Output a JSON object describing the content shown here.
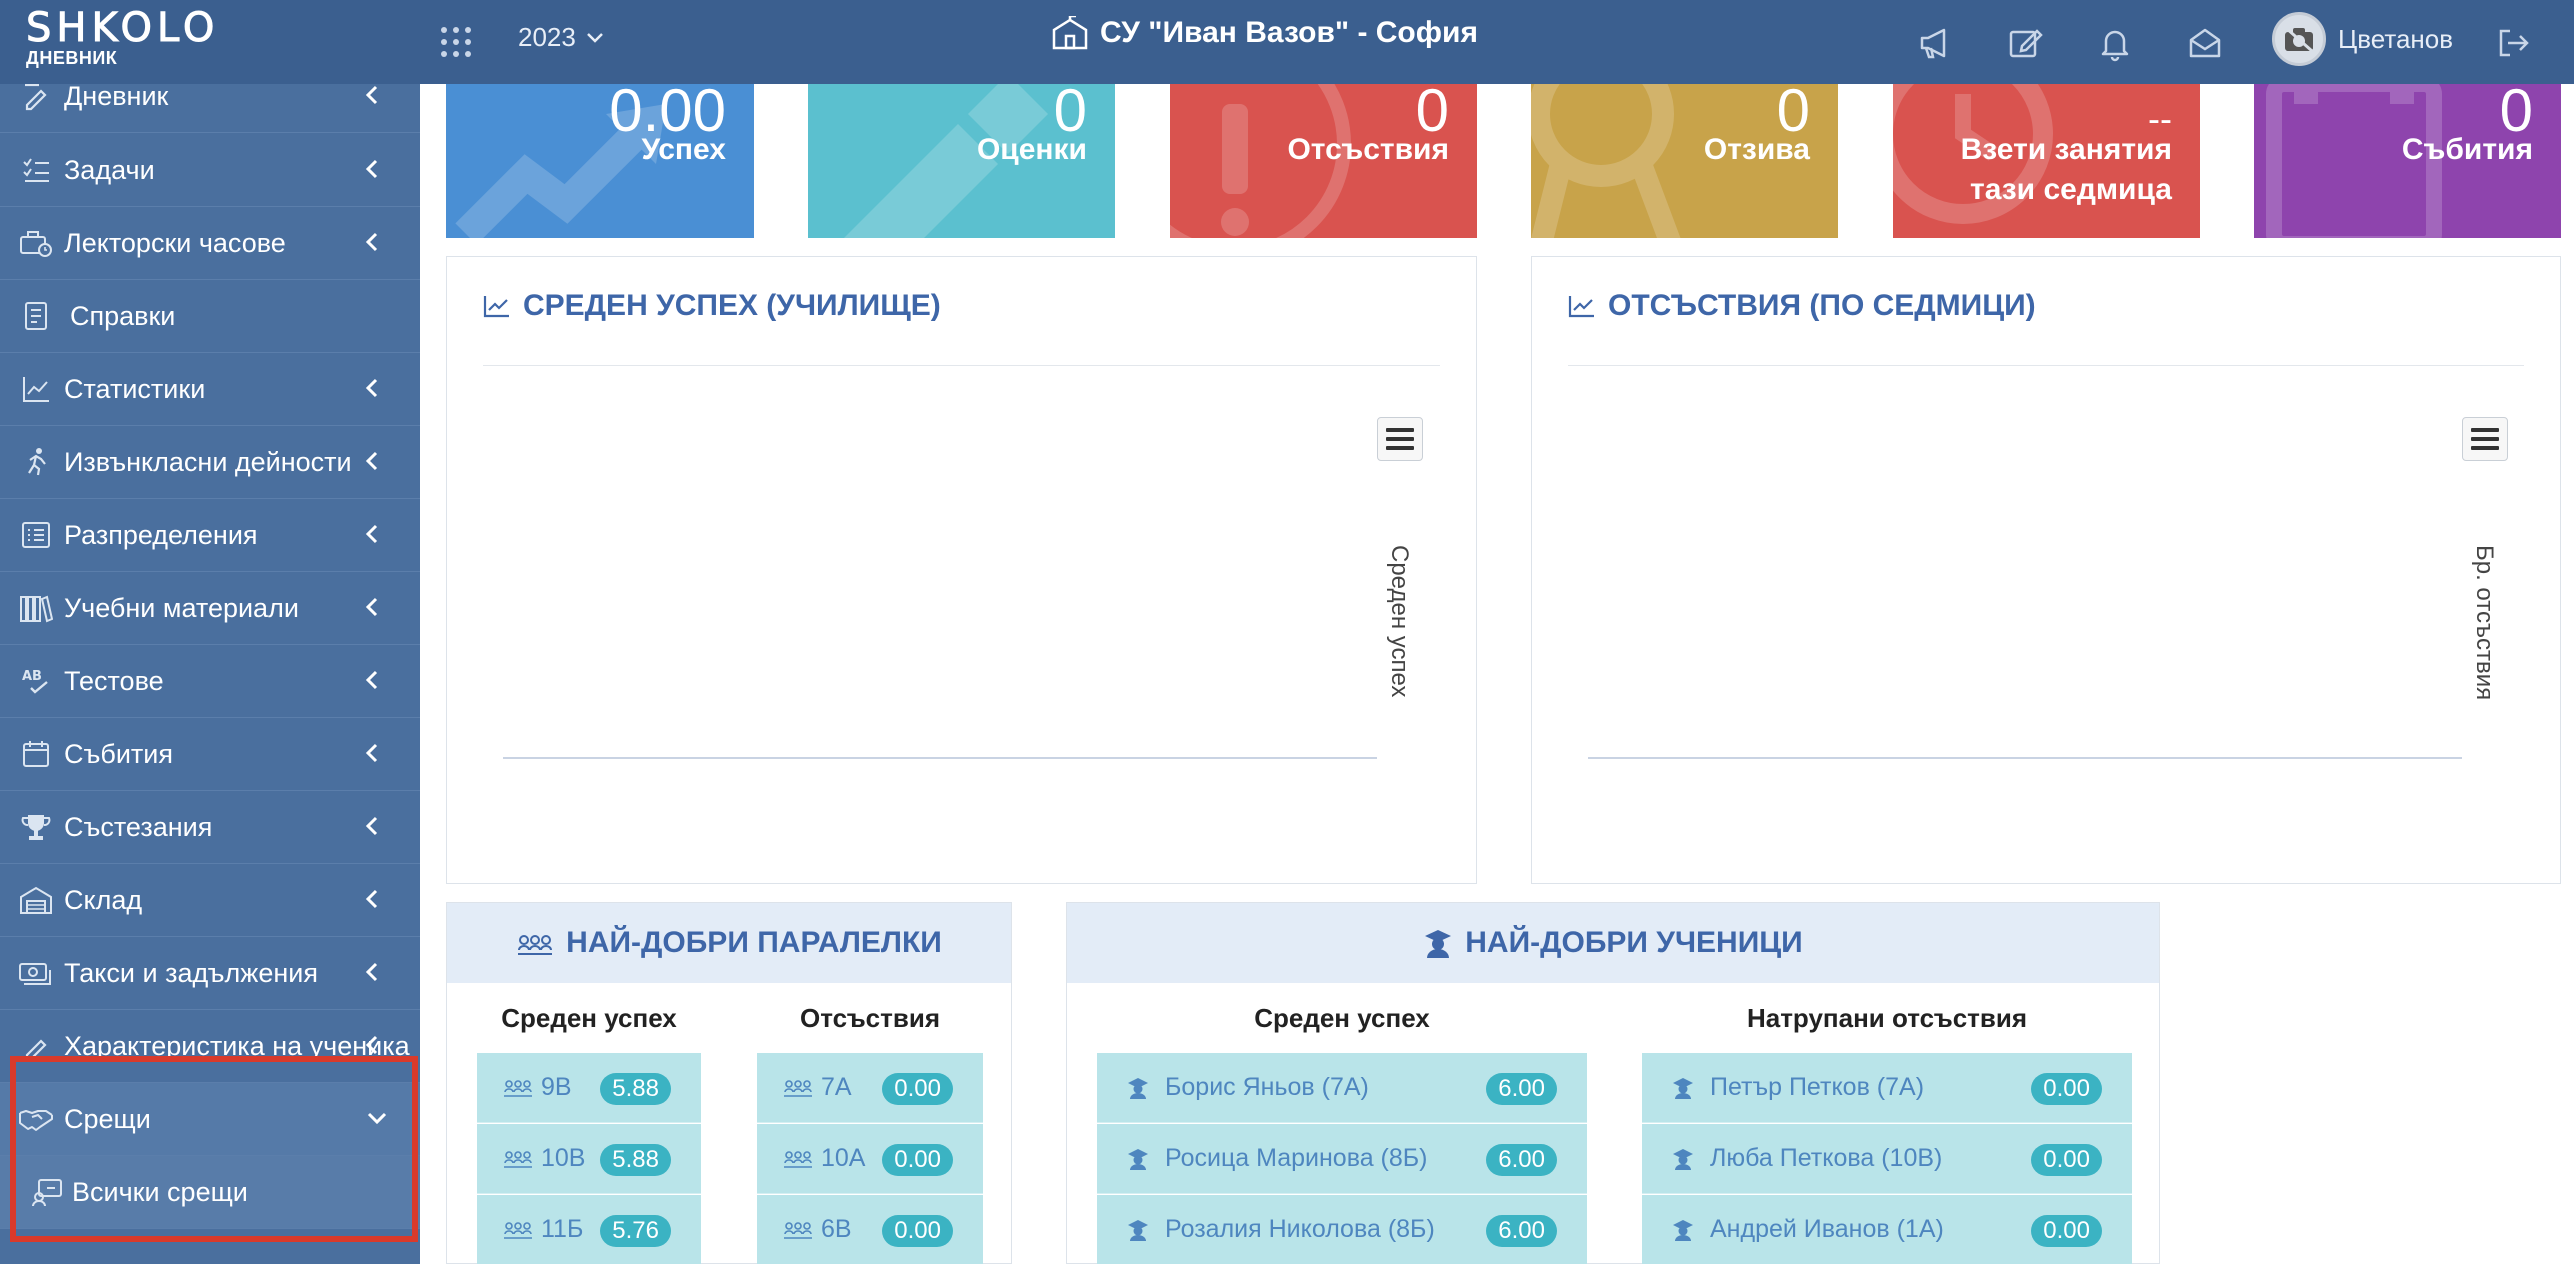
{
  "app": {
    "logo_word": "SHKOLO",
    "logo_sub": "ДНЕВНИК",
    "year": "2023",
    "school": "СУ \"Иван Вазов\" - София",
    "user": "Цветанов"
  },
  "sidebar": {
    "items": [
      {
        "label": "Дневник",
        "icon": "journal-icon"
      },
      {
        "label": "Задачи",
        "icon": "tasks-icon"
      },
      {
        "label": "Лекторски часове",
        "icon": "lecture-hours-icon"
      },
      {
        "label": "Справки",
        "icon": "reports-icon"
      },
      {
        "label": "Статистики",
        "icon": "statistics-icon"
      },
      {
        "label": "Извънкласни дейности",
        "icon": "extracurricular-icon"
      },
      {
        "label": "Разпределения",
        "icon": "distribution-icon"
      },
      {
        "label": "Учебни материали",
        "icon": "materials-icon"
      },
      {
        "label": "Тестове",
        "icon": "tests-icon"
      },
      {
        "label": "Събития",
        "icon": "calendar-icon"
      },
      {
        "label": "Състезания",
        "icon": "trophy-icon"
      },
      {
        "label": "Склад",
        "icon": "warehouse-icon"
      },
      {
        "label": "Такси и задължения",
        "icon": "fees-icon"
      },
      {
        "label": "Характеристика на ученика",
        "icon": "characteristic-icon"
      },
      {
        "label": "Срещи",
        "icon": "handshake-icon"
      },
      {
        "label": "Всички срещи",
        "icon": "meeting-icon"
      }
    ]
  },
  "tiles": [
    {
      "value": "0.00",
      "label": "Успех",
      "color": "#4a8fd4"
    },
    {
      "value": "0",
      "label": "Оценки",
      "color": "#5bc0cf"
    },
    {
      "value": "0",
      "label": "Отсъствия",
      "color": "#d9534f"
    },
    {
      "value": "0",
      "label": "Отзива",
      "color": "#c8a34a"
    },
    {
      "value": "--",
      "label_line1": "Взети занятия",
      "label_line2": "тази седмица",
      "color": "#d9534f"
    },
    {
      "value": "0",
      "label": "Събития",
      "color": "#8e44ad"
    }
  ],
  "charts": {
    "avg": {
      "title": "СРЕДЕН УСПЕХ (УЧИЛИЩЕ)",
      "ylabel": "Среден успех"
    },
    "absences": {
      "title": "ОТСЪСТВИЯ (ПО СЕДМИЦИ)",
      "ylabel": "Бр. отсъствия"
    }
  },
  "best_classes": {
    "title": "НАЙ-ДОБРИ ПАРАЛЕЛКИ",
    "col_avg": "Среден успех",
    "col_abs": "Отсъствия",
    "avg_rows": [
      {
        "name": "9В",
        "value": "5.88"
      },
      {
        "name": "10В",
        "value": "5.88"
      },
      {
        "name": "11Б",
        "value": "5.76"
      }
    ],
    "abs_rows": [
      {
        "name": "7А",
        "value": "0.00"
      },
      {
        "name": "10А",
        "value": "0.00"
      },
      {
        "name": "6В",
        "value": "0.00"
      }
    ]
  },
  "best_students": {
    "title": "НАЙ-ДОБРИ УЧЕНИЦИ",
    "col_avg": "Среден успех",
    "col_abs": "Натрупани отсъствия",
    "avg_rows": [
      {
        "name": "Борис Яньов (7А)",
        "value": "6.00"
      },
      {
        "name": "Росица Маринова (8Б)",
        "value": "6.00"
      },
      {
        "name": "Розалия Николова (8Б)",
        "value": "6.00"
      }
    ],
    "abs_rows": [
      {
        "name": "Петър Петков (7А)",
        "value": "0.00"
      },
      {
        "name": "Люба Петкова (10В)",
        "value": "0.00"
      },
      {
        "name": "Андрей Иванов (1А)",
        "value": "0.00"
      }
    ]
  }
}
